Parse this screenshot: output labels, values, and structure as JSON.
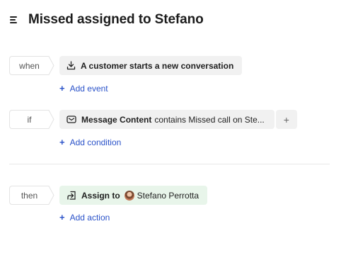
{
  "header": {
    "title": "Missed assigned to Stefano"
  },
  "when": {
    "tag": "when",
    "event_label": "A customer starts a new conversation",
    "add_label": "Add event",
    "add_plus": "+"
  },
  "if": {
    "tag": "if",
    "field": "Message Content",
    "condition_text": "contains Missed call on Ste...",
    "plus": "+",
    "add_label": "Add condition",
    "add_plus": "+"
  },
  "then": {
    "tag": "then",
    "action": "Assign to",
    "assignee": "Stefano Perrotta",
    "add_label": "Add action",
    "add_plus": "+"
  },
  "icons": {
    "menu": "menu-icon",
    "download": "download-icon",
    "message": "message-icon",
    "assign": "assign-icon"
  },
  "colors": {
    "accent_link": "#2a52c9",
    "chip_bg": "#f1f1f1",
    "action_chip_bg": "#e8f5ea"
  }
}
